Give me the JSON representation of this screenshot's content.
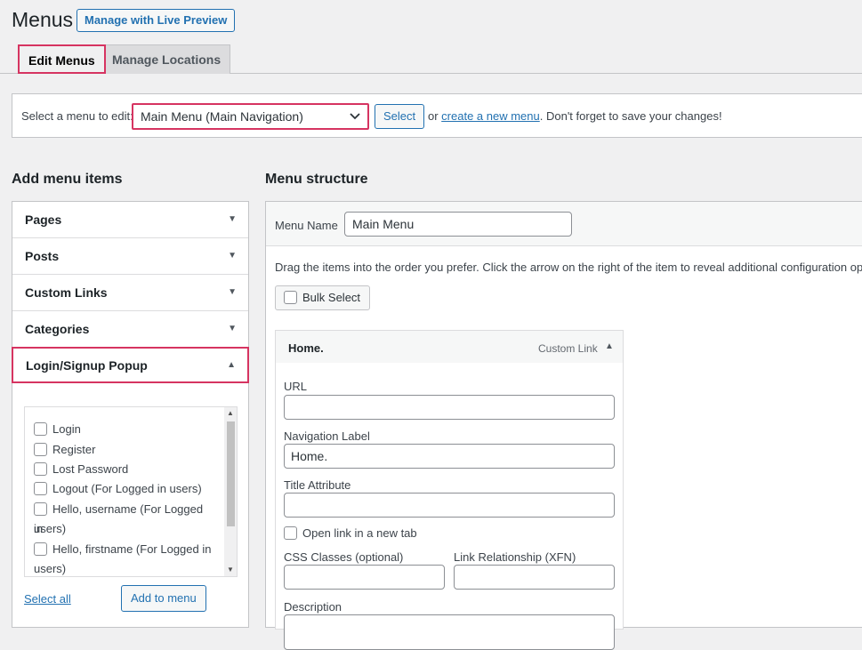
{
  "header": {
    "title": "Menus",
    "live_preview_label": "Manage with Live Preview"
  },
  "tabs": [
    {
      "label": "Edit Menus",
      "active": true
    },
    {
      "label": "Manage Locations",
      "active": false
    }
  ],
  "select_bar": {
    "label": "Select a menu to edit:",
    "selected_menu": "Main Menu (Main Navigation)",
    "select_button": "Select",
    "help_prefix": "or ",
    "create_link": "create a new menu",
    "help_suffix": ". Don't forget to save your changes!"
  },
  "left": {
    "heading": "Add menu items",
    "sections": [
      {
        "label": "Pages",
        "expanded": false
      },
      {
        "label": "Posts",
        "expanded": false
      },
      {
        "label": "Custom Links",
        "expanded": false
      },
      {
        "label": "Categories",
        "expanded": false
      },
      {
        "label": "Login/Signup Popup",
        "expanded": true
      }
    ],
    "popup_items": [
      {
        "label": "Login"
      },
      {
        "label": "Register"
      },
      {
        "label": "Lost Password"
      },
      {
        "label": "Logout (For Logged in users)"
      },
      {
        "label_line1": "Hello, username (For Logged in",
        "label_line2": "users)"
      },
      {
        "label_line1": "Hello, firstname (For Logged in",
        "label_line2": "users)"
      }
    ],
    "select_all": "Select all",
    "add_to_menu": "Add to menu"
  },
  "right": {
    "heading": "Menu structure",
    "menu_name_label": "Menu Name",
    "menu_name_value": "Main Menu",
    "drag_help": "Drag the items into the order you prefer. Click the arrow on the right of the item to reveal additional configuration options.",
    "bulk_select": "Bulk Select",
    "item": {
      "title": "Home.",
      "type": "Custom Link",
      "url_label": "URL",
      "url_value": "",
      "nav_label": "Navigation Label",
      "nav_value": "Home.",
      "title_attr_label": "Title Attribute",
      "title_attr_value": "",
      "new_tab_label": "Open link in a new tab",
      "css_label": "CSS Classes (optional)",
      "xfn_label": "Link Relationship (XFN)",
      "description_label": "Description"
    }
  },
  "colors": {
    "accent": "#2271b1",
    "highlight": "#d63461",
    "background": "#f0f0f1"
  }
}
